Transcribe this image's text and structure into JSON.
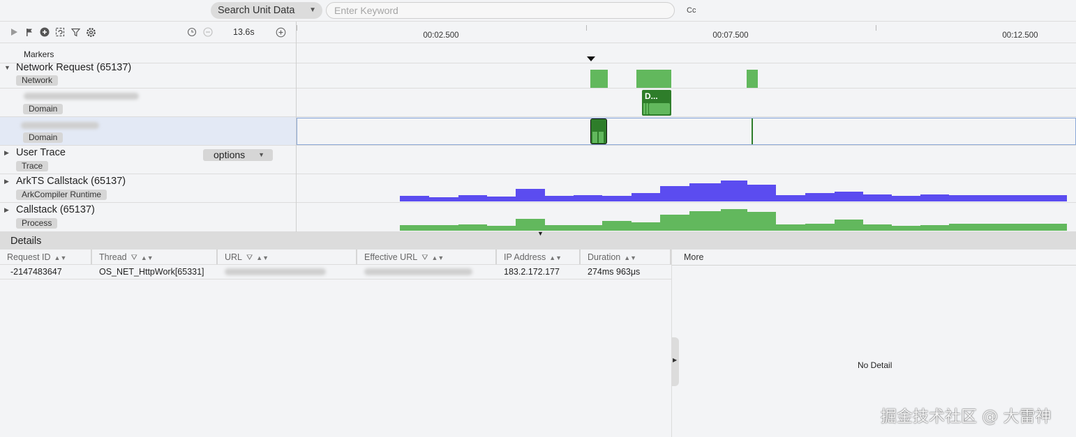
{
  "search": {
    "type_label": "Search Unit Data",
    "placeholder": "Enter Keyword",
    "case_toggle": "Cc"
  },
  "toolbar": {
    "zoom": "13.6s",
    "icons": [
      "play-icon",
      "flag-icon",
      "add-marker-icon",
      "refresh-icon",
      "filter-icon",
      "settings-icon",
      "clock-icon",
      "zoom-out-icon",
      "zoom-in-icon"
    ]
  },
  "ruler": {
    "ticks": [
      "00:02.500",
      "00:07.500",
      "00:12.500"
    ]
  },
  "lanes": {
    "markers": "Markers",
    "network": {
      "title": "Network Request (65137)",
      "tag": "Network"
    },
    "domain1": {
      "tag": "Domain",
      "block_label": "D..."
    },
    "domain2": {
      "tag": "Domain"
    },
    "user_trace": {
      "title": "User Trace",
      "tag": "Trace",
      "options_label": "options"
    },
    "arkts": {
      "title": "ArkTS Callstack (65137)",
      "tag": "ArkCompiler Runtime"
    },
    "callstack": {
      "title": "Callstack (65137)",
      "tag": "Process"
    }
  },
  "colors": {
    "network_green": "#62b85d",
    "selected_green": "#2e7d2a",
    "arkts_blue": "#5b4cf0",
    "callstack_green": "#62b85d",
    "selection_border": "#8aa8d8"
  },
  "details": {
    "title": "Details",
    "columns": [
      "Request ID",
      "Thread",
      "URL",
      "Effective URL",
      "IP Address",
      "Duration"
    ],
    "row": {
      "request_id": "-2147483647",
      "thread": "OS_NET_HttpWork[65331]",
      "ip": "183.2.172.177",
      "duration": "274ms 963μs"
    },
    "more_label": "More",
    "no_detail": "No Detail"
  },
  "watermark": "掘金技术社区 @ 大雷神"
}
